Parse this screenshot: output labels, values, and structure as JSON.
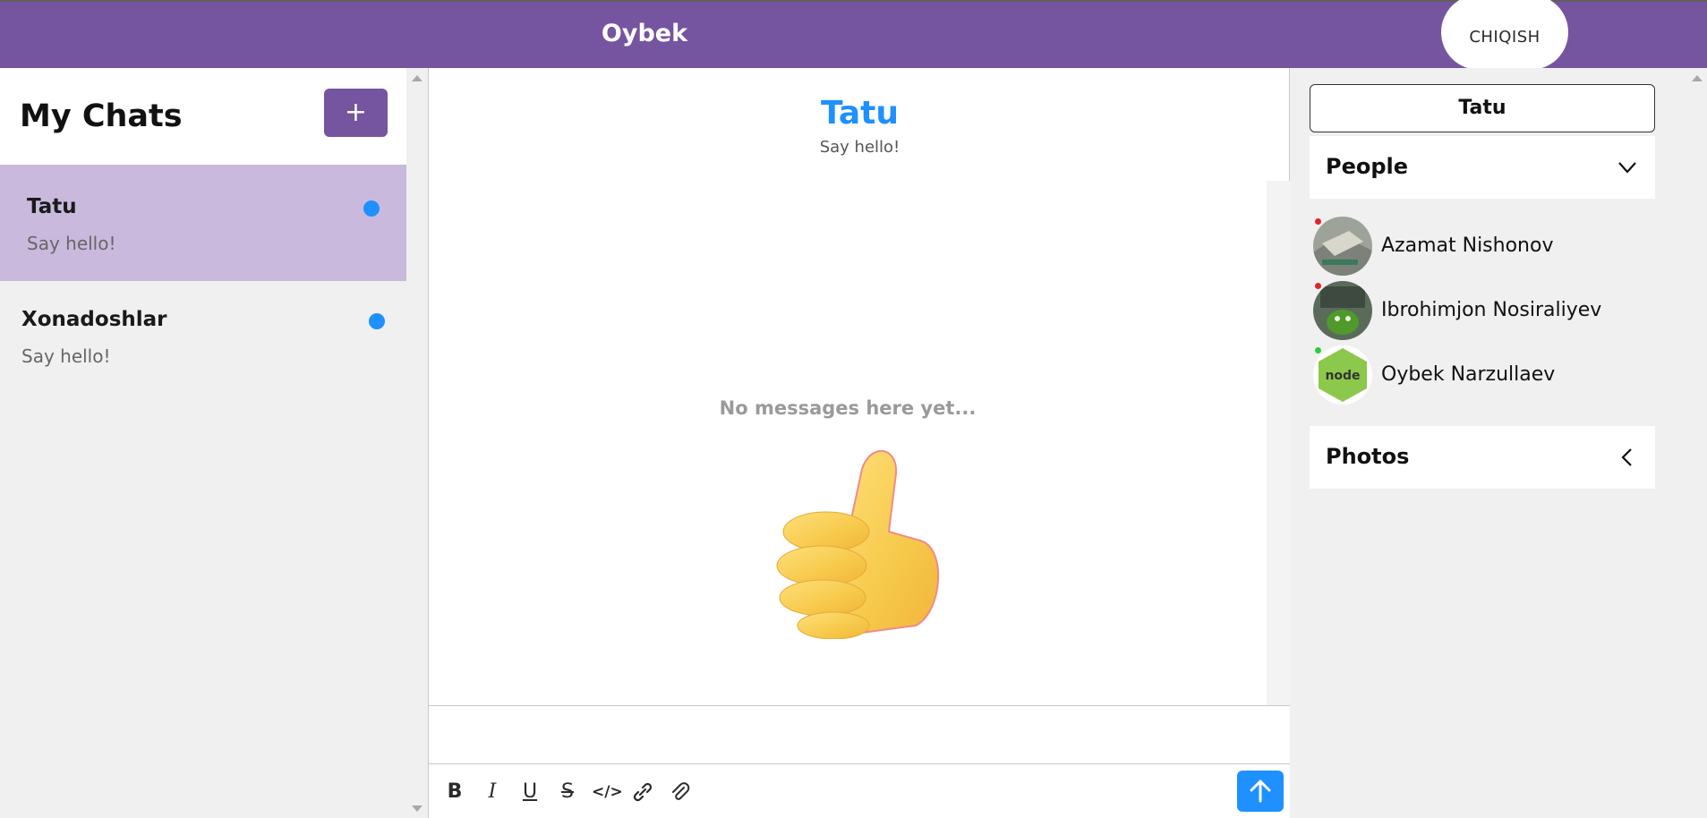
{
  "header": {
    "title": "Oybek",
    "logout_label": "CHIQISH"
  },
  "left": {
    "title": "My Chats",
    "new_chat_label": "+",
    "chats": [
      {
        "name": "Tatu",
        "preview": "Say hello!",
        "active": true
      },
      {
        "name": "Xonadoshlar",
        "preview": "Say hello!",
        "active": false
      }
    ]
  },
  "chat": {
    "title": "Tatu",
    "subtitle": "Say hello!",
    "empty_text": "No messages here yet...",
    "toolbar": [
      "bold-icon",
      "italic-icon",
      "underline-icon",
      "strikethrough-icon",
      "code-icon",
      "link-icon",
      "attachment-icon"
    ],
    "send_icon": "arrow-up-icon"
  },
  "right": {
    "chat_name": "Tatu",
    "people_label": "People",
    "photos_label": "Photos",
    "people": [
      {
        "name": "Azamat Nishonov",
        "status_color": "#e0232a"
      },
      {
        "name": "Ibrohimjon Nosiraliyev",
        "status_color": "#e0232a"
      },
      {
        "name": "Oybek Narzullaev",
        "status_color": "#2ecc40"
      }
    ]
  },
  "colors": {
    "brand": "#7554a0",
    "accent": "#1e90ff",
    "active_chat": "#c9b9dd"
  }
}
